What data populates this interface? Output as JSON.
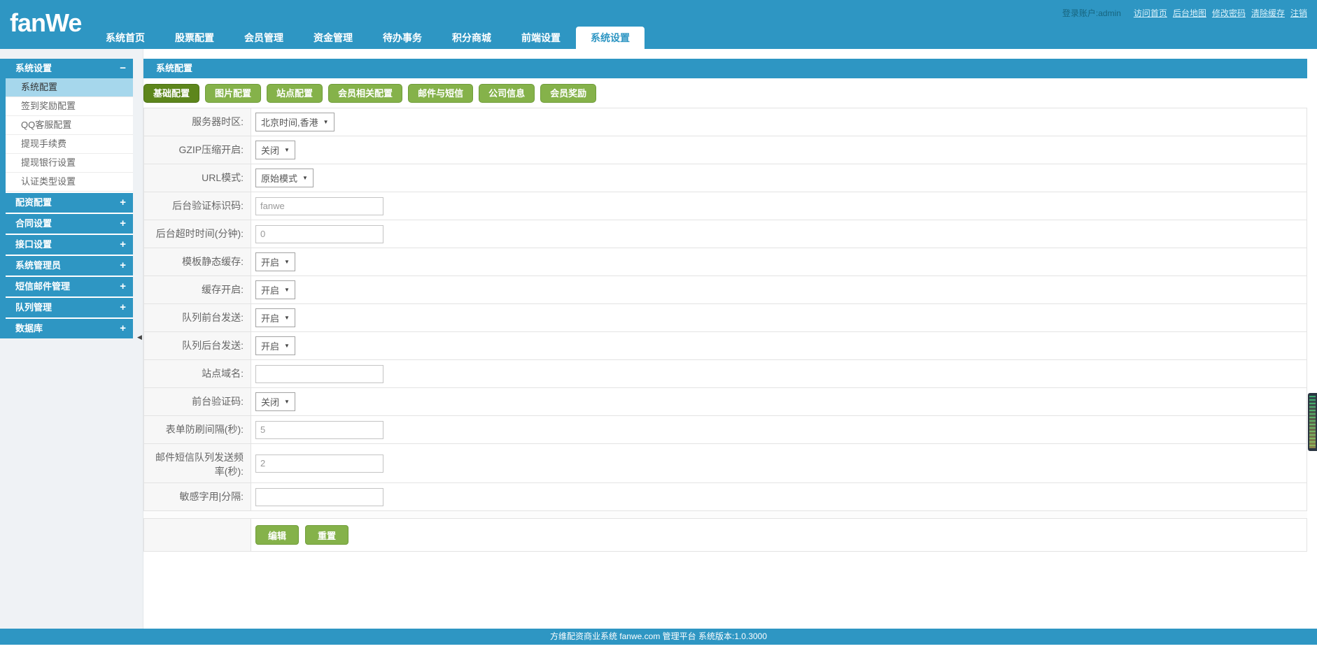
{
  "header": {
    "logo": "fanWe",
    "account": "登录账户:admin",
    "nav": [
      {
        "id": "home",
        "label": "系统首页"
      },
      {
        "id": "stock-config",
        "label": "股票配置"
      },
      {
        "id": "member-mgmt",
        "label": "会员管理"
      },
      {
        "id": "fund-mgmt",
        "label": "资金管理"
      },
      {
        "id": "todo-tasks",
        "label": "待办事务"
      },
      {
        "id": "points-mall",
        "label": "积分商城"
      },
      {
        "id": "front-settings",
        "label": "前端设置"
      },
      {
        "id": "system-settings",
        "label": "系统设置",
        "active": true
      }
    ],
    "quick_links": [
      {
        "id": "visit-home",
        "label": "访问首页"
      },
      {
        "id": "admin-map",
        "label": "后台地图"
      },
      {
        "id": "change-password",
        "label": "修改密码"
      },
      {
        "id": "clear-cache",
        "label": "清除缓存"
      },
      {
        "id": "logout",
        "label": "注销"
      }
    ]
  },
  "sidebar": {
    "sections": [
      {
        "id": "system-settings",
        "label": "系统设置",
        "expanded": true,
        "items": [
          {
            "id": "system-config",
            "label": "系统配置",
            "active": true
          },
          {
            "id": "signin-reward-config",
            "label": "签到奖励配置"
          },
          {
            "id": "qq-service-config",
            "label": "QQ客服配置"
          },
          {
            "id": "withdraw-fee",
            "label": "提现手续费"
          },
          {
            "id": "withdraw-bank-settings",
            "label": "提现银行设置"
          },
          {
            "id": "auth-type-settings",
            "label": "认证类型设置"
          }
        ]
      },
      {
        "id": "allocation-config",
        "label": "配资配置",
        "expanded": false
      },
      {
        "id": "contract-settings",
        "label": "合同设置",
        "expanded": false
      },
      {
        "id": "interface-settings",
        "label": "接口设置",
        "expanded": false
      },
      {
        "id": "system-admins",
        "label": "系统管理员",
        "expanded": false
      },
      {
        "id": "sms-mail-mgmt",
        "label": "短信邮件管理",
        "expanded": false
      },
      {
        "id": "queue-mgmt",
        "label": "队列管理",
        "expanded": false
      },
      {
        "id": "database",
        "label": "数据库",
        "expanded": false
      }
    ]
  },
  "main": {
    "panel_title": "系统配置",
    "tabs": [
      {
        "id": "basic-config",
        "label": "基础配置",
        "active": true
      },
      {
        "id": "image-config",
        "label": "图片配置"
      },
      {
        "id": "site-config",
        "label": "站点配置"
      },
      {
        "id": "member-config",
        "label": "会员相关配置"
      },
      {
        "id": "mail-sms",
        "label": "邮件与短信"
      },
      {
        "id": "company-info",
        "label": "公司信息"
      },
      {
        "id": "member-reward",
        "label": "会员奖励"
      }
    ],
    "form": {
      "rows": [
        {
          "id": "server-timezone",
          "label": "服务器时区:",
          "type": "select",
          "value": "北京时间,香港"
        },
        {
          "id": "gzip",
          "label": "GZIP压缩开启:",
          "type": "select",
          "value": "关闭"
        },
        {
          "id": "url-mode",
          "label": "URL模式:",
          "type": "select",
          "value": "原始模式"
        },
        {
          "id": "admin-auth-code",
          "label": "后台验证标识码:",
          "type": "input",
          "value": "fanwe"
        },
        {
          "id": "admin-timeout",
          "label": "后台超时时间(分钟):",
          "type": "input",
          "value": "0"
        },
        {
          "id": "template-cache",
          "label": "模板静态缓存:",
          "type": "select",
          "value": "开启"
        },
        {
          "id": "cache-enabled",
          "label": "缓存开启:",
          "type": "select",
          "value": "开启"
        },
        {
          "id": "queue-front-send",
          "label": "队列前台发送:",
          "type": "select",
          "value": "开启"
        },
        {
          "id": "queue-back-send",
          "label": "队列后台发送:",
          "type": "select",
          "value": "开启"
        },
        {
          "id": "site-domain",
          "label": "站点域名:",
          "type": "input",
          "value": ""
        },
        {
          "id": "front-captcha",
          "label": "前台验证码:",
          "type": "select",
          "value": "关闭"
        },
        {
          "id": "form-throttle",
          "label": "表单防刷间隔(秒):",
          "type": "input",
          "value": "5"
        },
        {
          "id": "queue-send-rate",
          "label": "邮件短信队列发送频率(秒):",
          "type": "input",
          "value": "2"
        },
        {
          "id": "sensitive-words",
          "label": "敏感字用|分隔:",
          "type": "input",
          "value": ""
        }
      ],
      "buttons": [
        {
          "id": "edit",
          "label": "编辑"
        },
        {
          "id": "reset",
          "label": "重置"
        }
      ]
    }
  },
  "footer": {
    "text": "方维配资商业系统 fanwe.com 管理平台 系统版本:1.0.3000"
  },
  "colors": {
    "brand_blue": "#2e96c3",
    "active_item_blue": "#a6d7ec",
    "tab_green": "#85b24a",
    "tab_green_active": "#5d861c"
  }
}
